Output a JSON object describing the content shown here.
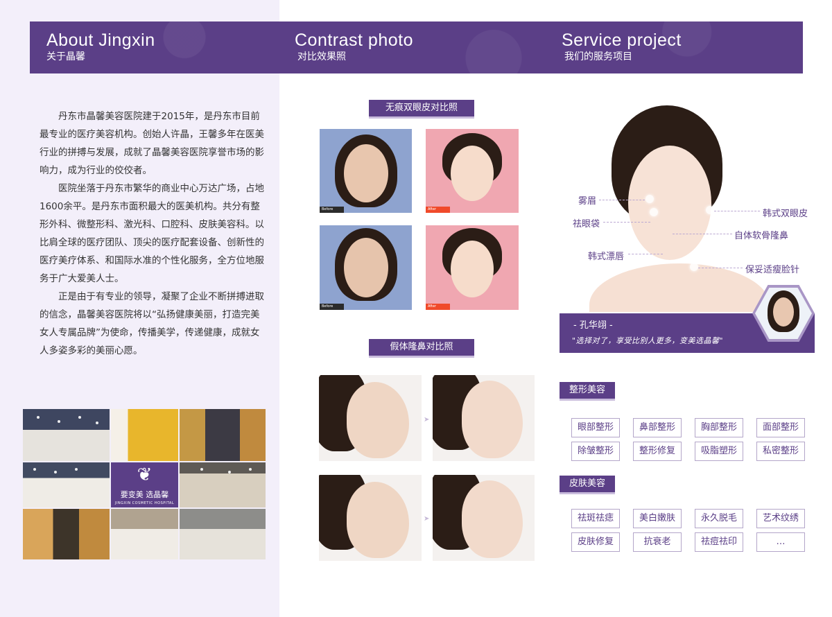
{
  "header": {
    "sections": [
      {
        "en": "About Jingxin",
        "cn": "关于晶馨"
      },
      {
        "en": "Contrast photo",
        "cn": "对比效果照"
      },
      {
        "en": "Service project",
        "cn": "我们的服务项目"
      }
    ]
  },
  "intro": {
    "paragraphs": [
      "丹东市晶馨美容医院建于2015年，是丹东市目前最专业的医疗美容机构。创始人许晶，王馨多年在医美行业的拼搏与发展，成就了晶馨美容医院享誉市场的影响力，成为行业的佼佼者。",
      "医院坐落于丹东市繁华的商业中心万达广场，占地1600余平。是丹东市面积最大的医美机构。共分有整形外科、微整形科、激光科、口腔科、皮肤美容科。以比肩全球的医疗团队、顶尖的医疗配套设备、创新性的医疗美疗体系、和国际水准的个性化服务，全方位地服务于广大爱美人士。",
      "正是由于有专业的领导，凝聚了企业不断拼搏进取的信念，晶馨美容医院将以“弘扬健康美丽，打造完美女人专属品牌”为使命，传播美学，传递健康，成就女人多姿多彩的美丽心愿。"
    ]
  },
  "gallery": {
    "logo_slogan": "要变美 选晶馨",
    "logo_sub": "JINGXIN COSMETIC HOSPITAL"
  },
  "contrast": {
    "eyelid_title": "无痕双眼皮对比照",
    "nose_title": "假体隆鼻对比照",
    "before_tag": "Before",
    "after_tag": "After"
  },
  "portrait": {
    "labels": {
      "brow": "雾眉",
      "eyebag": "祛眼袋",
      "lip": "韩式漂唇",
      "eyelid": "韩式双眼皮",
      "nose": "自体软骨隆鼻",
      "face": "保妥适瘦脸针"
    },
    "name": "- 孔华翊 -",
    "quote": "\"选择对了，享受比别人更多，变美选晶馨\""
  },
  "services": {
    "plastic_title": "整形美容",
    "plastic_items": [
      "眼部整形",
      "鼻部整形",
      "胸部整形",
      "面部整形",
      "除皱整形",
      "整形修复",
      "吸脂塑形",
      "私密整形"
    ],
    "skin_title": "皮肤美容",
    "skin_items": [
      "祛斑祛痣",
      "美白嫩肤",
      "永久脱毛",
      "艺术纹绣",
      "皮肤修复",
      "抗衰老",
      "祛痘祛印",
      "…"
    ]
  },
  "colors": {
    "brand_purple": "#5b3f87",
    "left_panel_bg": "#f3effa"
  }
}
